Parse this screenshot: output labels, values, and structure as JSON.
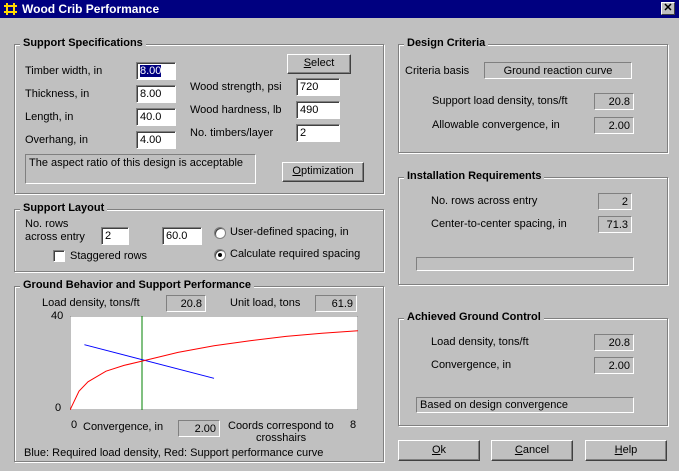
{
  "window": {
    "title": "Wood Crib Performance",
    "close_label": "✕"
  },
  "support_specs": {
    "title": "Support Specifications",
    "timber_width_label": "Timber width, in",
    "timber_width": "8.00",
    "thickness_label": "Thickness, in",
    "thickness": "8.00",
    "length_label": "Length, in",
    "length": "40.0",
    "overhang_label": "Overhang, in",
    "overhang": "4.00",
    "select_label": "Select",
    "wood_strength_label": "Wood strength, psi",
    "wood_strength": "720",
    "wood_hardness_label": "Wood hardness, lb",
    "wood_hardness": "490",
    "timbers_label": "No. timbers/layer",
    "timbers": "2",
    "message": "The aspect ratio of this design is acceptable",
    "optimization_label": "Optimization"
  },
  "support_layout": {
    "title": "Support Layout",
    "rows_label_1": "No. rows",
    "rows_label_2": "across entry",
    "rows": "2",
    "spacing": "60.0",
    "staggered_label": "Staggered rows",
    "staggered_checked": false,
    "user_defined_label": "User-defined spacing, in",
    "calculate_label": "Calculate required spacing",
    "selected_option": "calculate"
  },
  "ground_behavior": {
    "title": "Ground Behavior and Support Performance",
    "load_density_label": "Load density, tons/ft",
    "load_density": "20.8",
    "unit_load_label": "Unit load, tons",
    "unit_load": "61.9",
    "convergence_label": "Convergence, in",
    "convergence": "2.00",
    "coords_note_1": "Coords correspond to",
    "coords_note_2": "crosshairs",
    "legend": "Blue: Required load density, Red: Support performance curve"
  },
  "chart_data": {
    "type": "line",
    "xlim": [
      0,
      8
    ],
    "ylim": [
      0,
      40
    ],
    "x_tick_labels": [
      "0",
      "8"
    ],
    "y_tick_labels": [
      "0",
      "40"
    ],
    "xlabel": "Convergence, in",
    "crosshair": {
      "x": 2.0,
      "y": 20.8
    },
    "series": [
      {
        "color": "#0000ff",
        "x": [
          0.4,
          4.0
        ],
        "y": [
          27.8,
          13.5
        ]
      },
      {
        "color": "#ff0000",
        "x": [
          0.0,
          0.25,
          0.5,
          1.0,
          1.5,
          2.0,
          3.0,
          4.0,
          5.0,
          6.0,
          7.0,
          8.0
        ],
        "y": [
          0.0,
          8.0,
          12.0,
          16.5,
          19.0,
          20.8,
          24.5,
          27.3,
          29.5,
          31.3,
          32.7,
          33.7
        ]
      }
    ]
  },
  "design_criteria": {
    "title": "Design Criteria",
    "basis_label": "Criteria basis",
    "basis": "Ground reaction curve",
    "support_density_label": "Support load density, tons/ft",
    "support_density": "20.8",
    "allowable_conv_label": "Allowable convergence, in",
    "allowable_conv": "2.00"
  },
  "installation": {
    "title": "Installation Requirements",
    "rows_label": "No. rows across entry",
    "rows": "2",
    "spacing_label": "Center-to-center spacing, in",
    "spacing": "71.3",
    "status": ""
  },
  "achieved": {
    "title": "Achieved Ground Control",
    "load_density_label": "Load density, tons/ft",
    "load_density": "20.8",
    "convergence_label": "Convergence, in",
    "convergence": "2.00",
    "note": "Based on design convergence"
  },
  "buttons": {
    "ok_u": "O",
    "ok_rest": "k",
    "cancel_u": "C",
    "cancel_rest": "ancel",
    "help_u": "H",
    "help_rest": "elp"
  },
  "colors": {
    "titlebar": "#000080",
    "face": "#c0c0c0",
    "blue_curve": "#0000ff",
    "red_curve": "#ff0000",
    "crosshair": "#008000"
  }
}
